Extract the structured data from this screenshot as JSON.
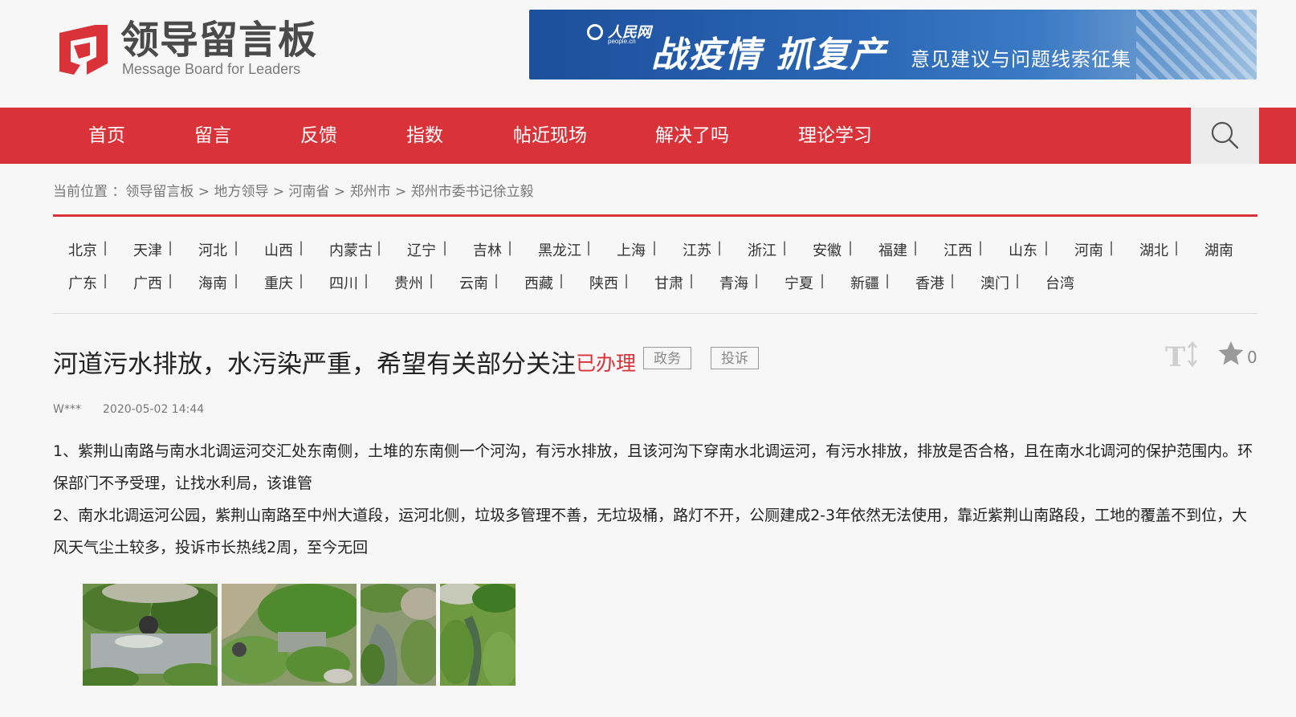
{
  "header": {
    "logo_title": "领导留言板",
    "logo_subtitle": "Message Board for Leaders",
    "banner": {
      "brand": "人民网",
      "brand_sub": "people.cn",
      "main": "战疫情  抓复产",
      "sub": "意见建议与问题线索征集"
    }
  },
  "nav": {
    "items": [
      {
        "label": "首页"
      },
      {
        "label": "留言"
      },
      {
        "label": "反馈"
      },
      {
        "label": "指数"
      },
      {
        "label": "帖近现场"
      },
      {
        "label": "解决了吗"
      },
      {
        "label": "理论学习"
      }
    ],
    "search_icon": "search-icon"
  },
  "breadcrumb": {
    "prefix": "当前位置 ：",
    "items": [
      "领导留言板",
      "地方领导",
      "河南省",
      "郑州市",
      "郑州市委书记徐立毅"
    ],
    "separator": " > "
  },
  "provinces": {
    "row1": [
      "北京",
      "天津",
      "河北",
      "山西",
      "内蒙古",
      "辽宁",
      "吉林",
      "黑龙江",
      "上海",
      "江苏",
      "浙江",
      "安徽",
      "福建",
      "江西",
      "山东",
      "河南",
      "湖北",
      "湖南"
    ],
    "row2": [
      "广东",
      "广西",
      "海南",
      "重庆",
      "四川",
      "贵州",
      "云南",
      "西藏",
      "陕西",
      "甘肃",
      "青海",
      "宁夏",
      "新疆",
      "香港",
      "澳门",
      "台湾"
    ],
    "separator": "|"
  },
  "post": {
    "title": "河道污水排放，水污染严重，希望有关部分关注",
    "status": "已办理",
    "tags": [
      "政务",
      "投诉"
    ],
    "favorite_count": "0",
    "author": "W***",
    "date": "2020-05-02 14:44",
    "paragraphs": [
      "1、紫荆山南路与南水北调运河交汇处东南侧，土堆的东南侧一个河沟，有污水排放，且该河沟下穿南水北调运河，有污水排放，排放是否合格，且在南水北调河的保护范围内。环保部门不予受理，让找水利局，该谁管",
      "2、南水北调运河公园，紫荆山南路至中州大道段，运河北侧，垃圾多管理不善，无垃圾桶，路灯不开，公厕建成2-3年依然无法使用，靠近紫荆山南路段，工地的覆盖不到位，大风天气尘土较多，投诉市长热线2周，至今无回"
    ],
    "photos": [
      "photo-1",
      "photo-2",
      "photo-3",
      "photo-4"
    ]
  },
  "colors": {
    "brand_red": "#da3239",
    "banner_blue": "#2a66b5",
    "background": "#f7f7f8"
  }
}
